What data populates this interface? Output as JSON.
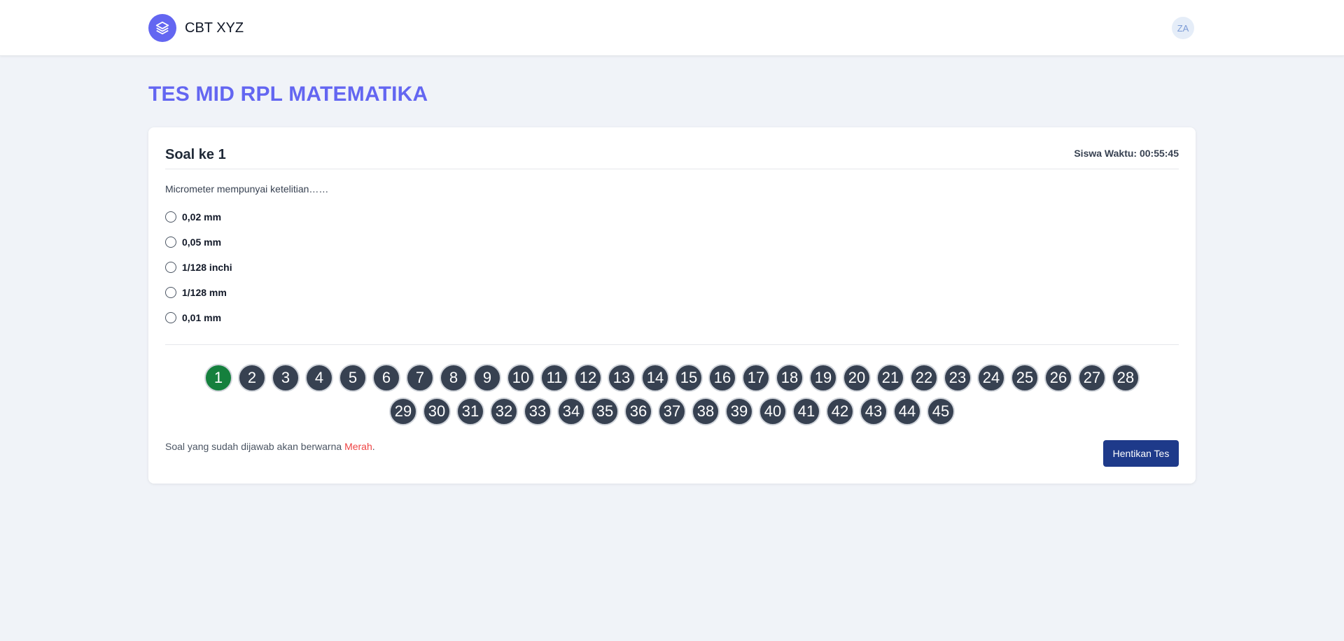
{
  "header": {
    "brand": "CBT XYZ",
    "logo_icon": "layers-icon",
    "avatar_initials": "ZA"
  },
  "page": {
    "title": "TES MID RPL MATEMATIKA"
  },
  "question": {
    "heading": "Soal ke 1",
    "timer": "Siswa Waktu: 00:55:45",
    "text": "Micrometer mempunyai ketelitian……",
    "options": [
      "0,02 mm",
      "0,05 mm",
      "1/128 inchi",
      "1/128 mm",
      "0,01 mm"
    ]
  },
  "navigator": {
    "numbers": [
      "1",
      "2",
      "3",
      "4",
      "5",
      "6",
      "7",
      "8",
      "9",
      "10",
      "11",
      "12",
      "13",
      "14",
      "15",
      "16",
      "17",
      "18",
      "19",
      "20",
      "21",
      "22",
      "23",
      "24",
      "25",
      "26",
      "27",
      "28",
      "29",
      "30",
      "31",
      "32",
      "33",
      "34",
      "35",
      "36",
      "37",
      "38",
      "39",
      "40",
      "41",
      "42",
      "43",
      "44",
      "45"
    ],
    "active_index": 0,
    "active_color": "#15803d",
    "default_color": "#374151"
  },
  "footer": {
    "hint_prefix": "Soal yang sudah dijawab akan berwarna ",
    "hint_highlight": "Merah",
    "hint_suffix": ".",
    "stop_label": "Hentikan Tes"
  },
  "colors": {
    "accent": "#6366f1",
    "stop_button": "#1e3a8a"
  }
}
